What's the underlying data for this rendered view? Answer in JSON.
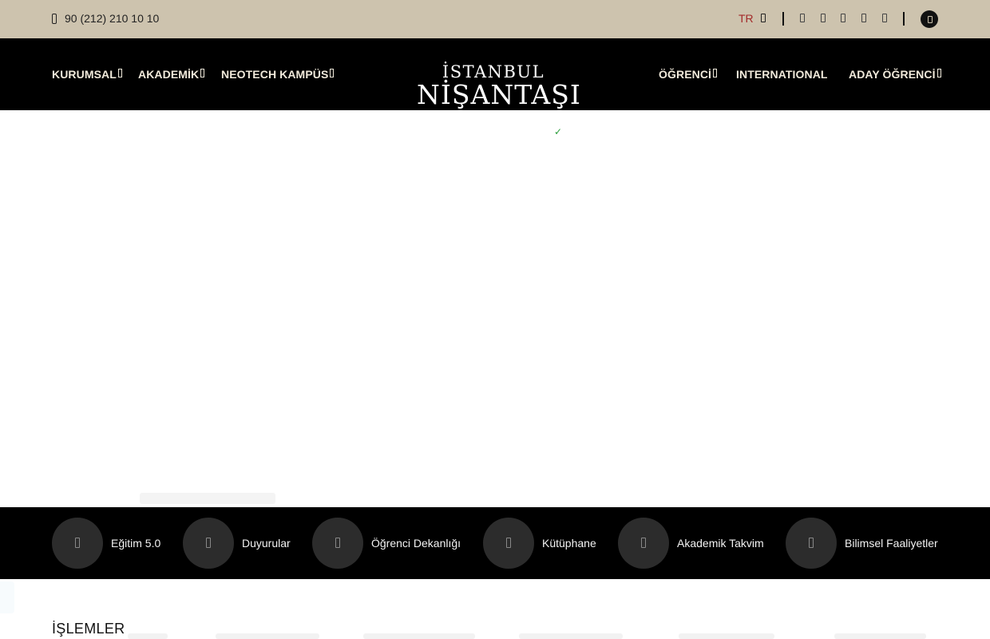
{
  "topbar": {
    "phone": "90 (212) 210 10 10",
    "phone_icon": "phone-icon",
    "language": "TR",
    "social_icons": [
      "facebook-icon",
      "twitter-icon",
      "instagram-icon",
      "linkedin-icon",
      "youtube-icon"
    ],
    "search_icon": "search-icon",
    "colors": {
      "background": "#cdc3ae",
      "language_text": "#a32a2a"
    }
  },
  "nav": {
    "left_items": [
      {
        "label": "KURUMSAL"
      },
      {
        "label": "AKADEMİK"
      },
      {
        "label": "NEOTECH KAMPÜS"
      }
    ],
    "logo": {
      "line1": "İSTANBUL",
      "line2": "NİŞANTAŞI"
    },
    "right_items": [
      {
        "label": "ÖĞRENCİ"
      },
      {
        "label": "INTERNATIONAL"
      },
      {
        "label": "ADAY ÖĞRENCİ"
      }
    ],
    "colors": {
      "background": "#000000",
      "text": "#f1eadb"
    }
  },
  "hero": {
    "loader_mark": "✓"
  },
  "quick_links": [
    {
      "label": "Eğitim 5.0",
      "icon": "education-icon"
    },
    {
      "label": "Duyurular",
      "icon": "announcement-icon"
    },
    {
      "label": "Öğrenci Dekanlığı",
      "icon": "student-dean-icon"
    },
    {
      "label": "Kütüphane",
      "icon": "library-icon"
    },
    {
      "label": "Akademik Takvim",
      "icon": "calendar-icon"
    },
    {
      "label": "Bilimsel Faaliyetler",
      "icon": "science-icon"
    }
  ],
  "section": {
    "title": "İŞLEMLER"
  }
}
